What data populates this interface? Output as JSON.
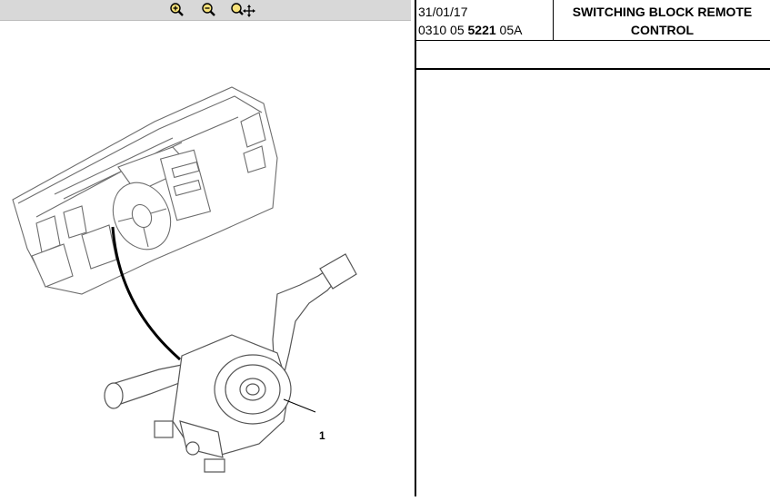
{
  "toolbar": {
    "zoom_in_icon": "zoom-in-icon",
    "zoom_out_icon": "zoom-out-icon",
    "zoom_pan_icon": "zoom-pan-icon"
  },
  "illustration": {
    "callouts": [
      "1"
    ]
  },
  "header": {
    "date": "31/01/17",
    "ref_prefix": "0310 05 ",
    "ref_bold": "5221",
    "ref_suffix": " 05A",
    "title": "SWITCHING BLOCK REMOTE CONTROL"
  },
  "colors": {
    "toolbar_bg": "#d8d8d8",
    "icon_yellow": "#f2c200"
  }
}
